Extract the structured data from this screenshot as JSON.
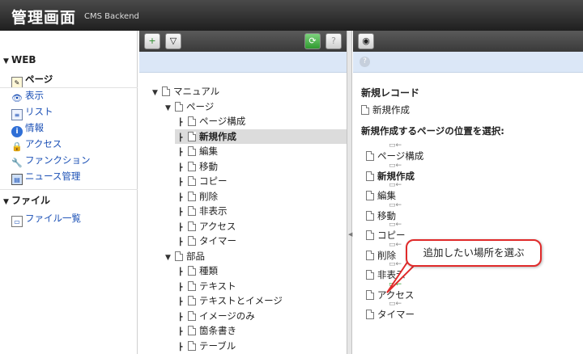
{
  "header": {
    "title": "管理画面",
    "subtitle": "CMS Backend"
  },
  "sidebar": {
    "web_section": "WEB",
    "items": [
      {
        "label": "ページ",
        "icon": "page-edit-icon"
      },
      {
        "label": "表示",
        "icon": "eye-icon"
      },
      {
        "label": "リスト",
        "icon": "list-icon"
      },
      {
        "label": "情報",
        "icon": "info-icon"
      },
      {
        "label": "アクセス",
        "icon": "lock-icon"
      },
      {
        "label": "ファンクション",
        "icon": "wrench-icon"
      },
      {
        "label": "ニュース管理",
        "icon": "news-icon"
      }
    ],
    "file_section": "ファイル",
    "file_items": [
      {
        "label": "ファイル一覧",
        "icon": "folder-icon"
      }
    ]
  },
  "tree": [
    {
      "label": "マニュアル",
      "depth": 0
    },
    {
      "label": "ページ",
      "depth": 1
    },
    {
      "label": "ページ構成",
      "depth": 2
    },
    {
      "label": "新規作成",
      "depth": 2,
      "selected": true
    },
    {
      "label": "編集",
      "depth": 2
    },
    {
      "label": "移動",
      "depth": 2
    },
    {
      "label": "コピー",
      "depth": 2
    },
    {
      "label": "削除",
      "depth": 2
    },
    {
      "label": "非表示",
      "depth": 2
    },
    {
      "label": "アクセス",
      "depth": 2
    },
    {
      "label": "タイマー",
      "depth": 2
    },
    {
      "label": "部品",
      "depth": 1
    },
    {
      "label": "種類",
      "depth": 2
    },
    {
      "label": "テキスト",
      "depth": 2
    },
    {
      "label": "テキストとイメージ",
      "depth": 2
    },
    {
      "label": "イメージのみ",
      "depth": 2
    },
    {
      "label": "箇条書き",
      "depth": 2
    },
    {
      "label": "テーブル",
      "depth": 2
    }
  ],
  "right": {
    "heading": "新規レコード",
    "new_item": "新規作成",
    "prompt": "新規作成するページの位置を選択:",
    "positions": [
      "ページ構成",
      "新規作成",
      "編集",
      "移動",
      "コピー",
      "削除",
      "非表示",
      "アクセス",
      "タイマー"
    ]
  },
  "callout": {
    "text": "追加したい場所を選ぶ",
    "border_color": "#e02a2a"
  }
}
